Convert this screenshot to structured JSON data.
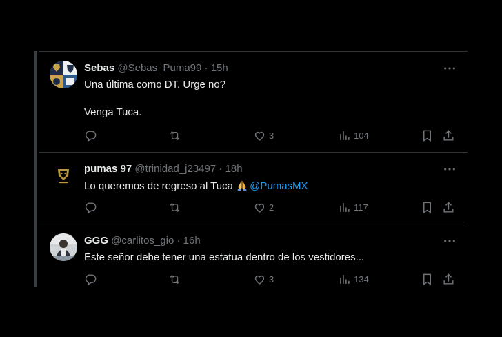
{
  "replies": [
    {
      "name": "Sebas",
      "handle": "@Sebas_Puma99",
      "dot": "·",
      "time": "15h",
      "body": "Una última como DT. Urge no?\n\nVenga Tuca.",
      "likes": "3",
      "views": "104",
      "avatar_icon": "pumas-collage-avatar"
    },
    {
      "name": "pumas 97",
      "handle": "@trinidad_j23497",
      "dot": "·",
      "time": "18h",
      "body_text": "Lo queremos de regreso al Tuca ",
      "emoji": "folded-hands",
      "mention": "@PumasMX",
      "likes": "2",
      "views": "117",
      "avatar_icon": "pumas-logo-avatar"
    },
    {
      "name": "GGG",
      "handle": "@carlitos_gio",
      "dot": "·",
      "time": "16h",
      "body": "Este señor debe tener una estatua dentro de los vestidores...",
      "likes": "3",
      "views": "134",
      "avatar_icon": "person-photo-avatar"
    }
  ],
  "colors": {
    "background": "#000000",
    "text": "#e7e9ea",
    "muted": "#71767b",
    "link": "#1d9bf0",
    "border": "#2f3336"
  }
}
